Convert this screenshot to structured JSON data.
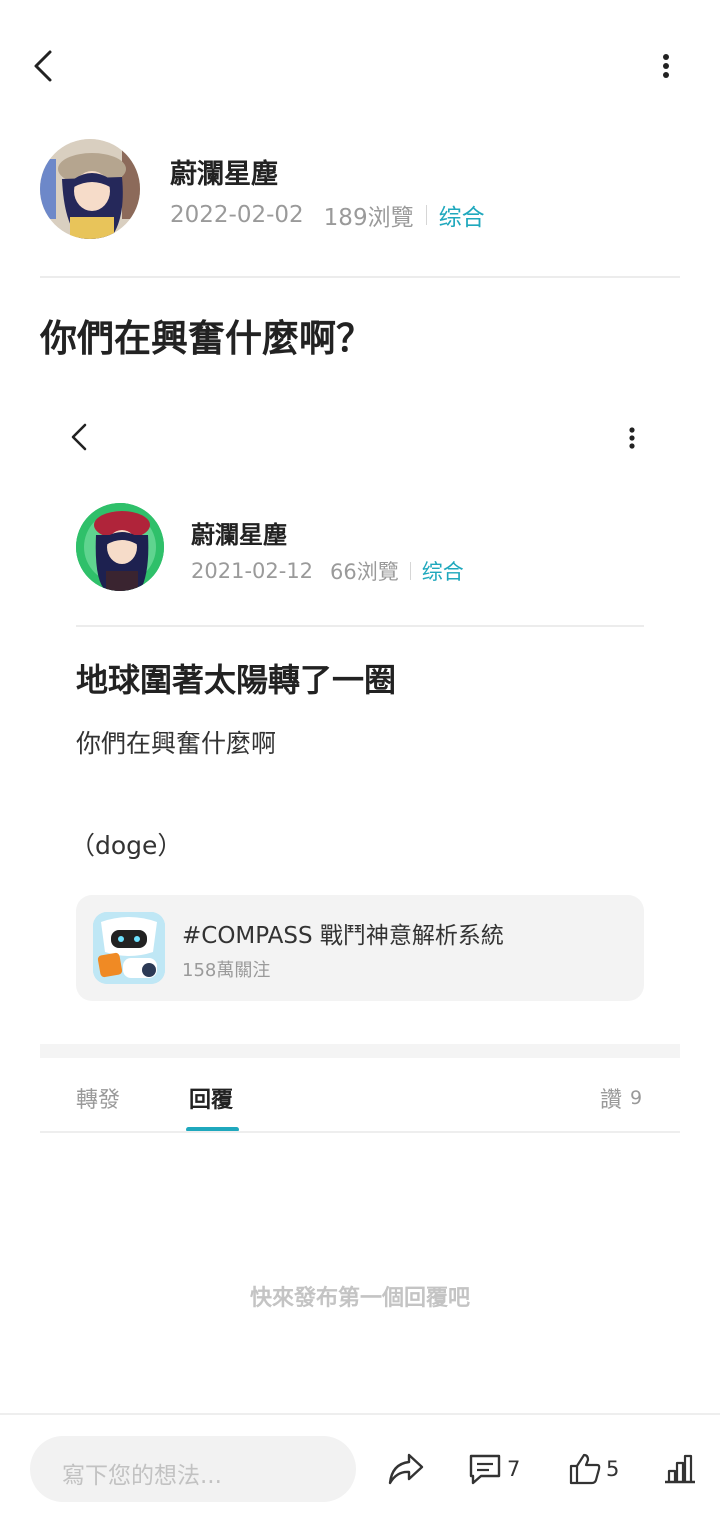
{
  "header": {
    "back_icon": "chevron-left-icon",
    "more_icon": "more-vertical-icon"
  },
  "author": {
    "name": "蔚瀾星塵",
    "date": "2022-02-02",
    "views": "189浏覽",
    "category": "综合"
  },
  "post": {
    "title": "你們在興奮什麼啊？"
  },
  "embedded": {
    "author": {
      "name": "蔚瀾星塵",
      "date": "2021-02-12",
      "views": "66浏覽",
      "category": "综合"
    },
    "title": "地球圍著太陽轉了一圈",
    "body": "你們在興奮什麼啊",
    "emoji_text": "（doge）",
    "topic": {
      "name": "#COMPASS 戰鬥神意解析系統",
      "followers": "158萬關注"
    }
  },
  "tabs": {
    "repost": "轉發",
    "reply": "回覆",
    "likes_label": "讚",
    "likes_count": "9"
  },
  "empty_state": "快來發布第一個回覆吧",
  "bottom_bar": {
    "comment_placeholder": "寫下您的想法...",
    "comments_count": "7",
    "likes_count": "5"
  },
  "colors": {
    "accent": "#1fa8bd",
    "muted": "#9a9a9a"
  }
}
